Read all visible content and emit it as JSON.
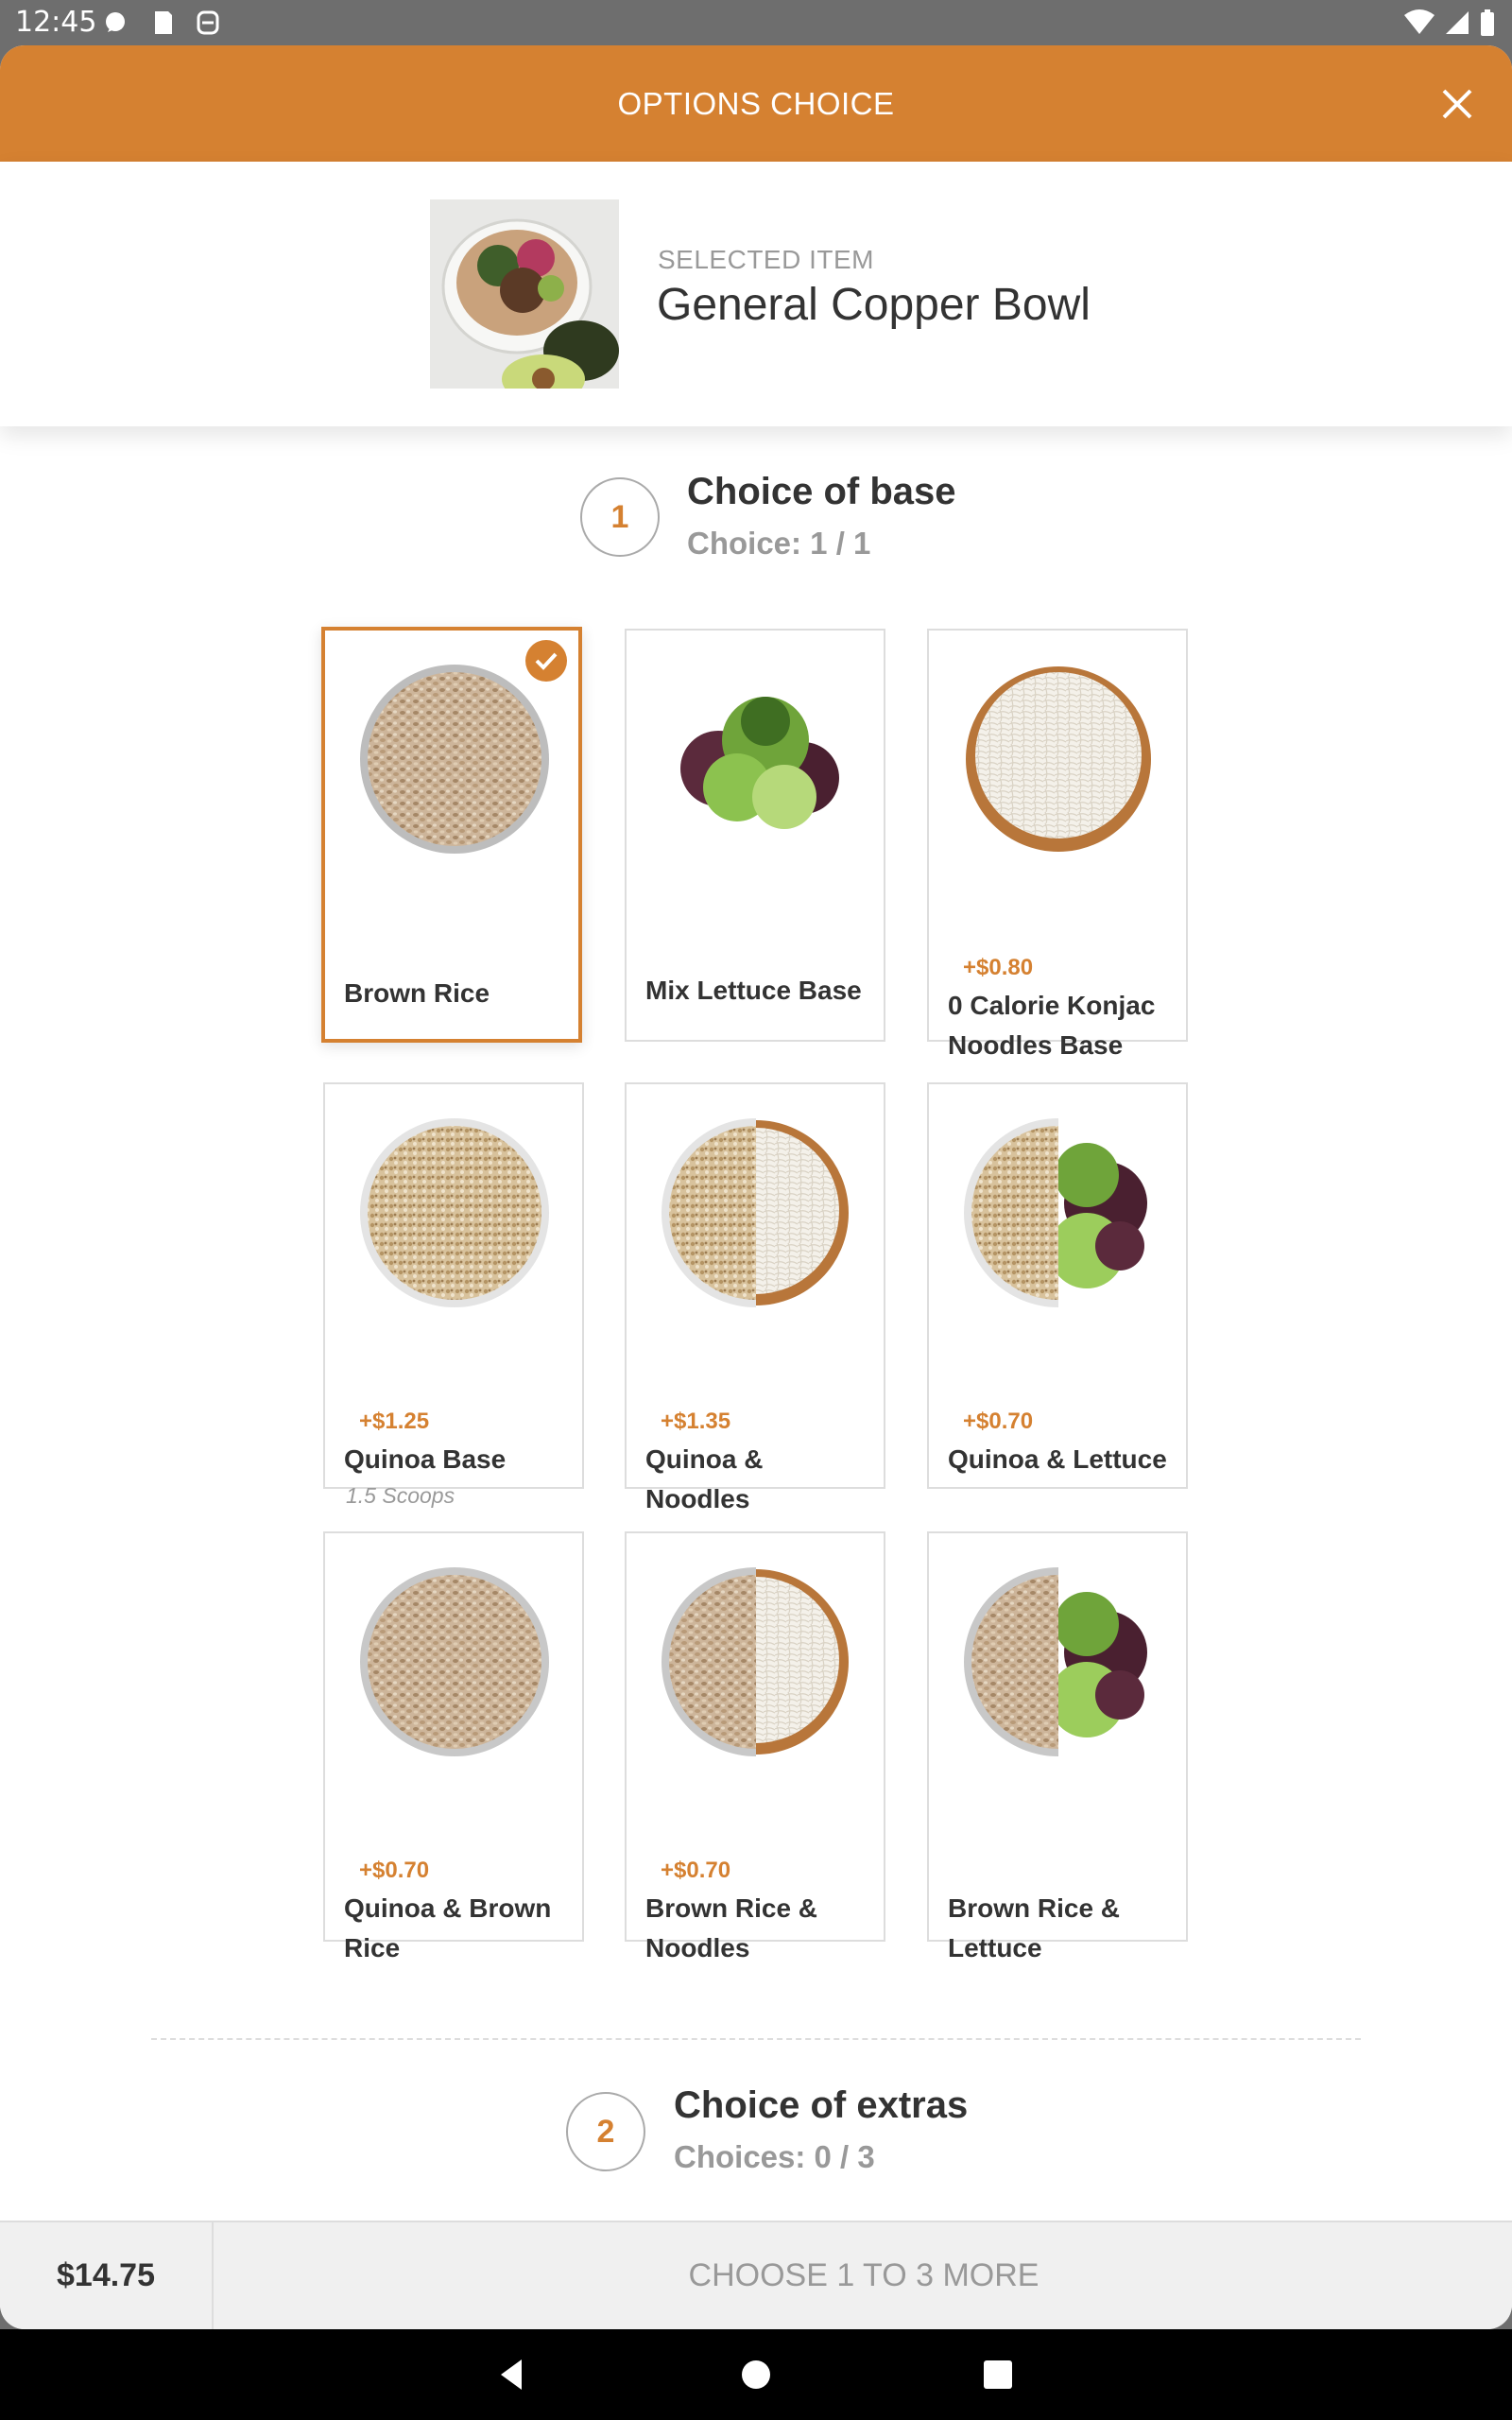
{
  "status_bar": {
    "time": "12:45",
    "icons": [
      "chat-icon",
      "sd-card-icon",
      "accessibility-icon",
      "wifi-icon",
      "signal-icon",
      "battery-icon"
    ]
  },
  "header": {
    "title": "OPTIONS CHOICE",
    "close_icon": "close-icon",
    "color": "#d58131"
  },
  "selected_item": {
    "label": "SELECTED ITEM",
    "name": "General Copper Bowl"
  },
  "steps": [
    {
      "number": "1",
      "title": "Choice of base",
      "subtitle": "Choice: 1 / 1"
    },
    {
      "number": "2",
      "title": "Choice of extras",
      "subtitle": "Choices: 0 / 3"
    }
  ],
  "base_options": [
    {
      "name": "Brown Rice",
      "price": "",
      "note": "",
      "selected": true,
      "image": "brown-rice-bowl"
    },
    {
      "name": "Mix Lettuce Base",
      "price": "",
      "note": "",
      "selected": false,
      "image": "lettuce"
    },
    {
      "name": "0 Calorie Konjac Noodles Base",
      "price": "+$0.80",
      "note": "",
      "selected": false,
      "image": "konjac-noodles-bowl"
    },
    {
      "name": "Quinoa Base",
      "price": "+$1.25",
      "note": "1.5 Scoops",
      "selected": false,
      "image": "quinoa-bowl"
    },
    {
      "name": "Quinoa & Noodles",
      "price": "+$1.35",
      "note": "",
      "selected": false,
      "image": "quinoa-noodles-bowl"
    },
    {
      "name": "Quinoa & Lettuce",
      "price": "+$0.70",
      "note": "",
      "selected": false,
      "image": "quinoa-lettuce-bowl"
    },
    {
      "name": "Quinoa & Brown Rice",
      "price": "+$0.70",
      "note": "",
      "selected": false,
      "image": "quinoa-brown-rice-bowl"
    },
    {
      "name": "Brown Rice & Noodles",
      "price": "+$0.70",
      "note": "",
      "selected": false,
      "image": "brown-rice-noodles-bowl"
    },
    {
      "name": "Brown Rice & Lettuce",
      "price": "",
      "note": "",
      "selected": false,
      "image": "brown-rice-lettuce-bowl"
    }
  ],
  "footer": {
    "price": "$14.75",
    "action": "CHOOSE 1 TO 3 MORE"
  },
  "nav": {
    "buttons": [
      "back-icon",
      "home-icon",
      "recents-icon"
    ]
  }
}
